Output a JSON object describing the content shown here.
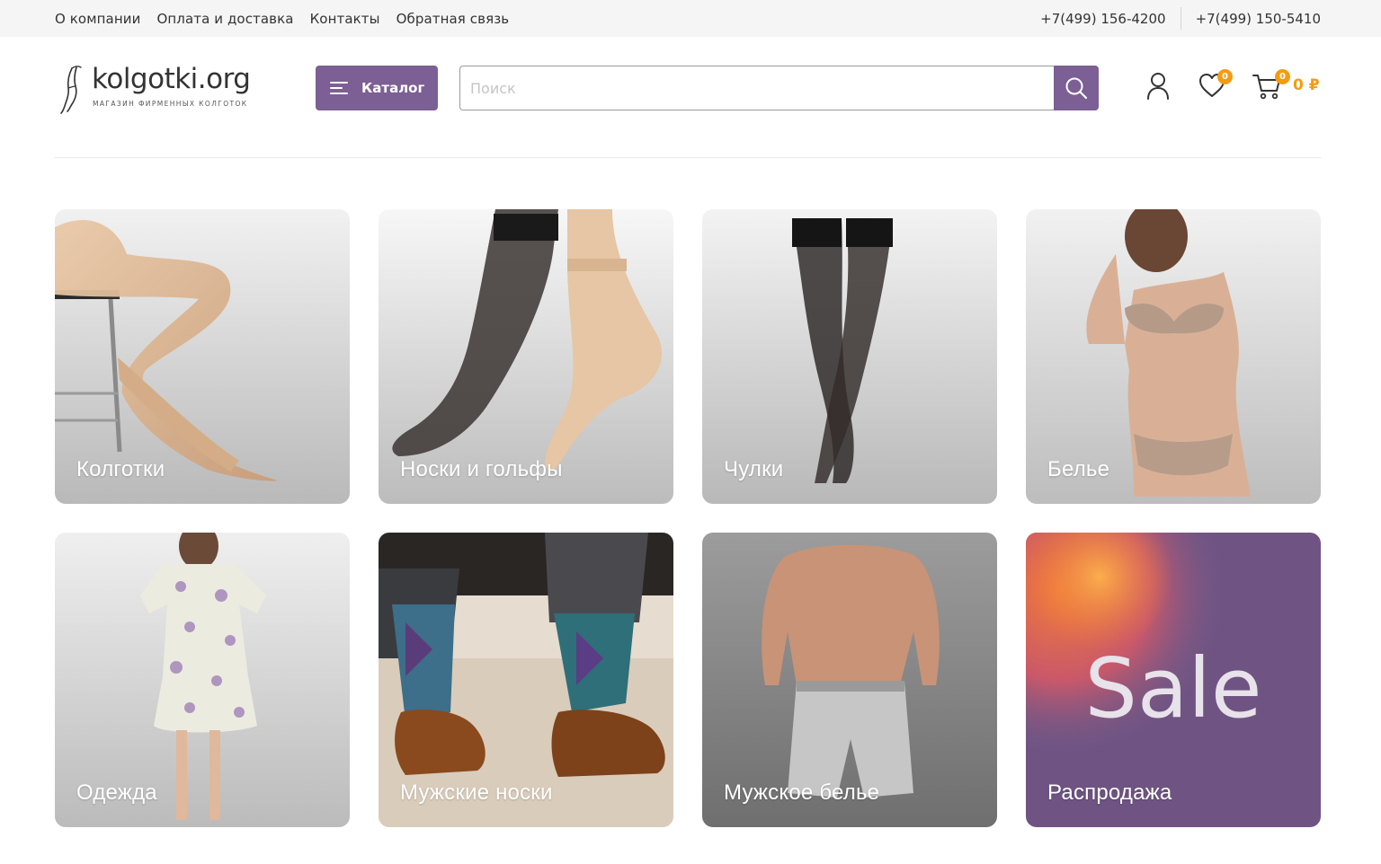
{
  "topbar": {
    "nav": [
      {
        "label": "О компании"
      },
      {
        "label": "Оплата и доставка"
      },
      {
        "label": "Контакты"
      },
      {
        "label": "Обратная связь"
      }
    ],
    "phones": [
      "+7(499) 156-4200",
      "+7(499) 150-5410"
    ]
  },
  "header": {
    "logo": {
      "name": "kolgotki.org",
      "tagline": "МАГАЗИН ФИРМЕННЫХ КОЛГОТОК"
    },
    "catalog_label": "Каталог",
    "search": {
      "placeholder": "Поиск",
      "value": ""
    },
    "icons": [
      "user-icon",
      "heart-icon",
      "cart-icon",
      "search-icon",
      "menu-icon"
    ],
    "favorites_count": "0",
    "cart_count": "0",
    "cart_total": "0 ₽"
  },
  "colors": {
    "accent": "#7c5f94",
    "badge": "#f39c12",
    "topbar_bg": "#f5f5f5"
  },
  "categories": [
    {
      "label": "Колготки"
    },
    {
      "label": "Носки и гольфы"
    },
    {
      "label": "Чулки"
    },
    {
      "label": "Белье"
    },
    {
      "label": "Одежда"
    },
    {
      "label": "Мужские носки"
    },
    {
      "label": "Мужское белье"
    },
    {
      "label": "Распродажа",
      "image_text": "Sale"
    }
  ]
}
